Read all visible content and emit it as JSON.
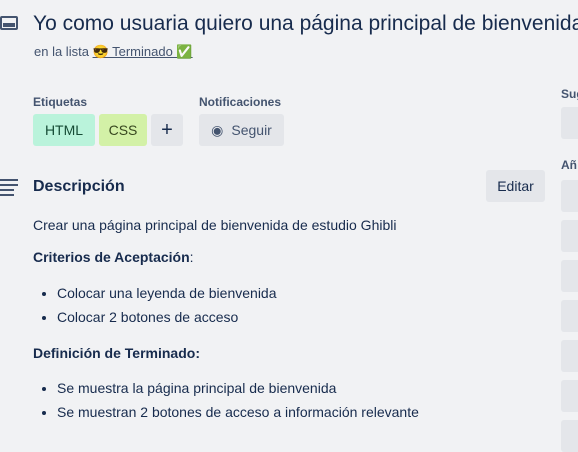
{
  "card": {
    "title": "Yo como usuaria quiero una página principal de bienvenida",
    "list_prefix": "en la lista",
    "list_name": "😎 Terminado ✅"
  },
  "labels": {
    "heading": "Etiquetas",
    "items": [
      {
        "text": "HTML",
        "color": "#baf3db"
      },
      {
        "text": "CSS",
        "color": "#d3f1a7"
      }
    ],
    "add": "+"
  },
  "notifications": {
    "heading": "Notificaciones",
    "follow": "Seguir"
  },
  "description": {
    "heading": "Descripción",
    "edit": "Editar",
    "intro": "Crear una página principal de bienvenida de estudio Ghibli",
    "criteria_heading": "Criterios de Aceptación",
    "criteria": [
      "Colocar una leyenda de bienvenida",
      "Colocar 2 botones de acceso"
    ],
    "done_heading": "Definición de Terminado:",
    "done": [
      "Se muestra la página principal de bienvenida",
      "Se muestran 2 botones de acceso a información relevante"
    ]
  },
  "sidebar": {
    "suggested": "Sug",
    "add": "Añ",
    "icons": [
      "member-icon",
      "member-icon",
      "label-icon",
      "checklist-icon",
      "clock-icon",
      "attachment-icon",
      "cover-icon",
      "custom-field-icon"
    ]
  }
}
